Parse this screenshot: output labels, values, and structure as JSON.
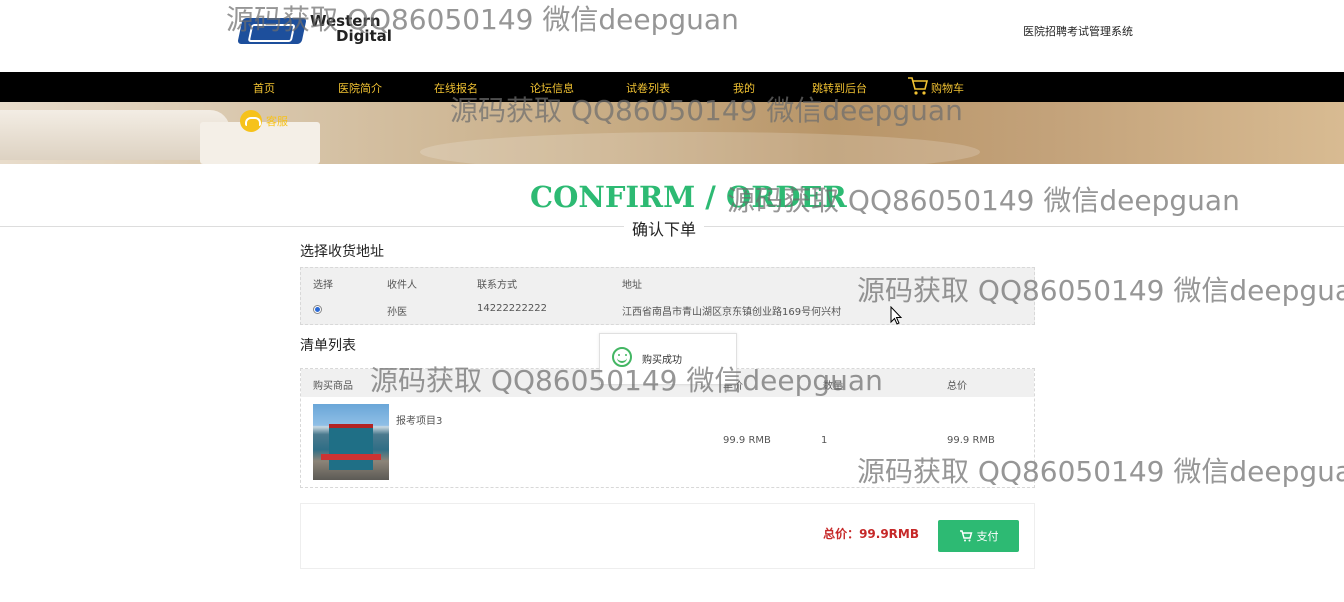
{
  "header": {
    "logo_text_1": "Western",
    "logo_text_2": "Digital",
    "site_title": "医院招聘考试管理系统"
  },
  "nav": {
    "items": [
      "首页",
      "医院简介",
      "在线报名",
      "论坛信息",
      "试卷列表",
      "我的",
      "跳转到后台"
    ],
    "cart_label": "购物车"
  },
  "banner": {
    "service_label": "客服"
  },
  "confirm": {
    "title_en": "CONFIRM / ORDER",
    "title_cn": "确认下单"
  },
  "address_section": {
    "title": "选择收货地址",
    "headers": [
      "选择",
      "收件人",
      "联系方式",
      "地址"
    ],
    "rows": [
      {
        "selected": true,
        "name": "孙医",
        "phone": "14222222222",
        "address": "江西省南昌市青山湖区京东镇创业路169号何兴村"
      }
    ]
  },
  "toast": {
    "message": "购买成功"
  },
  "list_section": {
    "title": "清单列表",
    "headers": [
      "购买商品",
      "单价",
      "数量",
      "总价"
    ],
    "rows": [
      {
        "product": "报考项目3",
        "price": "99.9 RMB",
        "quantity": "1",
        "total": "99.9 RMB"
      }
    ]
  },
  "summary": {
    "total_label": "总价：99.9RMB",
    "pay_label": "支付"
  },
  "watermark": {
    "text": "源码获取 QQ86050149 微信deepguan"
  },
  "colors": {
    "nav_bg": "#000000",
    "nav_text": "#f1c232",
    "accent_green": "#2dba73",
    "total_red": "#c62828"
  }
}
